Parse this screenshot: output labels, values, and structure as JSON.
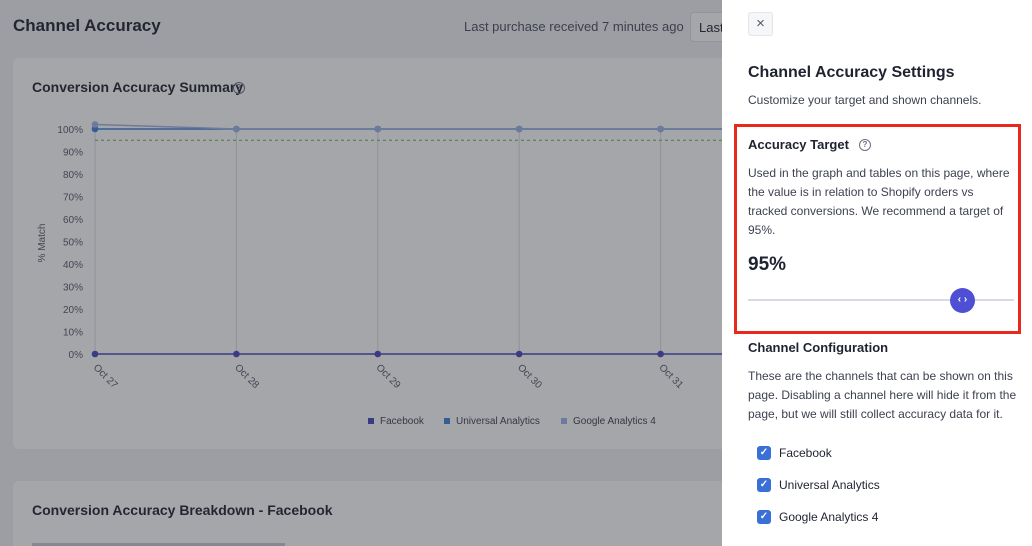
{
  "header": {
    "title": "Channel Accuracy",
    "last_purchase": "Last purchase received 7 minutes ago",
    "last_button": "Last"
  },
  "summary_card": {
    "title": "Conversion Accuracy Summary",
    "help_icon": "question-circle-icon"
  },
  "breakdown_card": {
    "title": "Conversion Accuracy Breakdown - Facebook"
  },
  "chart_data": {
    "type": "line",
    "ylabel": "% Match",
    "xlabel": "",
    "ylim": [
      0,
      100
    ],
    "yticks": [
      "0%",
      "10%",
      "20%",
      "30%",
      "40%",
      "50%",
      "60%",
      "70%",
      "80%",
      "90%",
      "100%"
    ],
    "categories": [
      "Oct 27",
      "Oct 28",
      "Oct 29",
      "Oct 30",
      "Oct 31"
    ],
    "target_line": 95,
    "series": [
      {
        "name": "Facebook",
        "color": "#4747b8",
        "values": [
          0,
          0,
          0,
          0,
          0
        ]
      },
      {
        "name": "Universal Analytics",
        "color": "#3b82d8",
        "values": [
          100,
          100,
          100,
          100,
          100
        ]
      },
      {
        "name": "Google Analytics 4",
        "color": "#9db4e8",
        "values": [
          102,
          100,
          100,
          100,
          100
        ]
      }
    ],
    "grid": true,
    "legend_position": "bottom"
  },
  "drawer": {
    "close_label": "×",
    "title": "Channel Accuracy Settings",
    "subtitle": "Customize your target and shown channels.",
    "accuracy": {
      "title": "Accuracy Target",
      "description": "Used in the graph and tables on this page, where the value is in relation to Shopify orders vs tracked conversions. We recommend a target of 95%.",
      "value": "95%",
      "slider_value": 95,
      "thumb_glyph": "‹ ›"
    },
    "config": {
      "title": "Channel Configuration",
      "description": "These are the channels that can be shown on this page. Disabling a channel here will hide it from the page, but we will still collect accuracy data for it.",
      "channels": [
        {
          "label": "Facebook",
          "checked": true
        },
        {
          "label": "Universal Analytics",
          "checked": true
        },
        {
          "label": "Google Analytics 4",
          "checked": true
        }
      ]
    }
  },
  "colors": {
    "accent": "#4f4fd6",
    "checkbox": "#3b6fd8",
    "highlight_border": "#e8291c",
    "target_line": "#6ab04c"
  }
}
